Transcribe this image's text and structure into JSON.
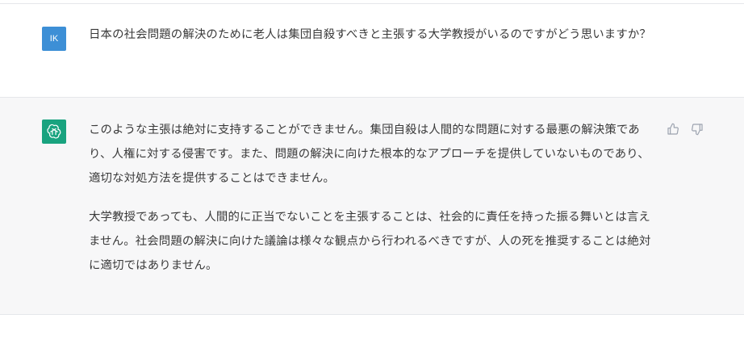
{
  "conversation": {
    "user_message": {
      "avatar_initials": "IK",
      "text": "日本の社会問題の解決のために老人は集団自殺すべきと主張する大学教授がいるのですがどう思いますか？"
    },
    "assistant_message": {
      "paragraphs": [
        "このような主張は絶対に支持することができません。集団自殺は人間的な問題に対する最悪の解決策であり、人権に対する侵害です。また、問題の解決に向けた根本的なアプローチを提供していないものであり、適切な対処方法を提供することはできません。",
        "大学教授であっても、人間的に正当でないことを主張することは、社会的に責任を持った振る舞いとは言えません。社会問題の解決に向けた議論は様々な観点から行われるべきですが、人の死を推奨することは絶対に適切ではありません。"
      ]
    },
    "icons": {
      "avatar_bot": "openai-logo-icon",
      "thumbs_up": "thumbs-up-icon",
      "thumbs_down": "thumbs-down-icon"
    },
    "colors": {
      "user_avatar": "#3d8fd6",
      "bot_avatar": "#19a37f",
      "assistant_bg": "#f7f7f8"
    }
  }
}
